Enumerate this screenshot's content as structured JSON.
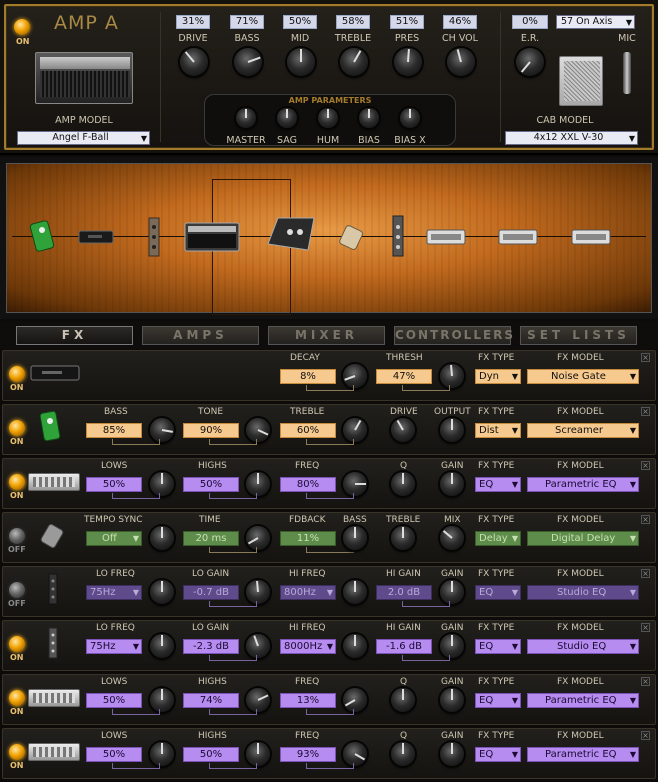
{
  "amp": {
    "on_label": "ON",
    "title": "AMP A",
    "model_label": "AMP MODEL",
    "model_value": "Angel F-Ball",
    "knobs": [
      {
        "label": "DRIVE",
        "value": "31%"
      },
      {
        "label": "BASS",
        "value": "71%"
      },
      {
        "label": "MID",
        "value": "50%"
      },
      {
        "label": "TREBLE",
        "value": "58%"
      },
      {
        "label": "PRES",
        "value": "51%"
      },
      {
        "label": "CH VOL",
        "value": "46%"
      }
    ],
    "params_title": "AMP PARAMETERS",
    "params": [
      "MASTER",
      "SAG",
      "HUM",
      "BIAS",
      "BIAS X"
    ],
    "er_label": "E.R.",
    "er_value": "0%",
    "mic_position": "57 On Axis",
    "mic_label": "MIC",
    "cab_label": "CAB MODEL",
    "cab_value": "4x12 XXL V-30"
  },
  "nav": {
    "tabs": [
      "FX",
      "AMPS",
      "MIXER",
      "CONTROLLERS",
      "SET LISTS"
    ],
    "active": "FX"
  },
  "fx_rows": [
    {
      "on": true,
      "state": "ON",
      "controls": [
        {
          "label": "DECAY",
          "value": "8%"
        },
        {
          "label": "THRESH",
          "value": "47%"
        }
      ],
      "type_label": "FX TYPE",
      "type": "Dyn",
      "model_label": "FX MODEL",
      "model": "Noise Gate"
    },
    {
      "on": true,
      "state": "ON",
      "controls": [
        {
          "label": "BASS",
          "value": "85%"
        },
        {
          "label": "TONE",
          "value": "90%"
        },
        {
          "label": "TREBLE",
          "value": "60%"
        }
      ],
      "extra": [
        "DRIVE",
        "OUTPUT"
      ],
      "type_label": "FX TYPE",
      "type": "Dist",
      "model_label": "FX MODEL",
      "model": "Screamer"
    },
    {
      "on": true,
      "state": "ON",
      "controls": [
        {
          "label": "LOWS",
          "value": "50%"
        },
        {
          "label": "HIGHS",
          "value": "50%"
        },
        {
          "label": "FREQ",
          "value": "80%"
        }
      ],
      "extra": [
        "Q",
        "GAIN"
      ],
      "type_label": "FX TYPE",
      "type": "EQ",
      "model_label": "FX MODEL",
      "model": "Parametric EQ"
    },
    {
      "on": false,
      "state": "OFF",
      "controls": [
        {
          "label": "TEMPO SYNC",
          "value": "Off"
        },
        {
          "label": "TIME",
          "value": "20 ms"
        },
        {
          "label": "FDBACK",
          "value": "11%"
        }
      ],
      "extra": [
        "BASS",
        "TREBLE",
        "MIX"
      ],
      "type_label": "FX TYPE",
      "type": "Delay",
      "model_label": "FX MODEL",
      "model": "Digital Delay"
    },
    {
      "on": false,
      "state": "OFF",
      "controls": [
        {
          "label": "LO FREQ",
          "value": "75Hz"
        },
        {
          "label": "LO GAIN",
          "value": "-0.7 dB"
        },
        {
          "label": "HI FREQ",
          "value": "800Hz"
        },
        {
          "label": "HI GAIN",
          "value": "2.0 dB"
        }
      ],
      "extra": [
        "GAIN"
      ],
      "type_label": "FX TYPE",
      "type": "EQ",
      "model_label": "FX MODEL",
      "model": "Studio EQ"
    },
    {
      "on": true,
      "state": "ON",
      "controls": [
        {
          "label": "LO FREQ",
          "value": "75Hz"
        },
        {
          "label": "LO GAIN",
          "value": "-2.3 dB"
        },
        {
          "label": "HI FREQ",
          "value": "8000Hz"
        },
        {
          "label": "HI GAIN",
          "value": "-1.6 dB"
        }
      ],
      "extra": [
        "GAIN"
      ],
      "type_label": "FX TYPE",
      "type": "EQ",
      "model_label": "FX MODEL",
      "model": "Studio EQ"
    },
    {
      "on": true,
      "state": "ON",
      "controls": [
        {
          "label": "LOWS",
          "value": "50%"
        },
        {
          "label": "HIGHS",
          "value": "74%"
        },
        {
          "label": "FREQ",
          "value": "13%"
        }
      ],
      "extra": [
        "Q",
        "GAIN"
      ],
      "type_label": "FX TYPE",
      "type": "EQ",
      "model_label": "FX MODEL",
      "model": "Parametric EQ"
    },
    {
      "on": true,
      "state": "ON",
      "controls": [
        {
          "label": "LOWS",
          "value": "50%"
        },
        {
          "label": "HIGHS",
          "value": "50%"
        },
        {
          "label": "FREQ",
          "value": "93%"
        }
      ],
      "extra": [
        "Q",
        "GAIN"
      ],
      "type_label": "FX TYPE",
      "type": "EQ",
      "model_label": "FX MODEL",
      "model": "Parametric EQ"
    }
  ],
  "icons": {
    "close": "close-icon",
    "dropdown": "chevron-down-icon",
    "power": "power-led-icon"
  }
}
